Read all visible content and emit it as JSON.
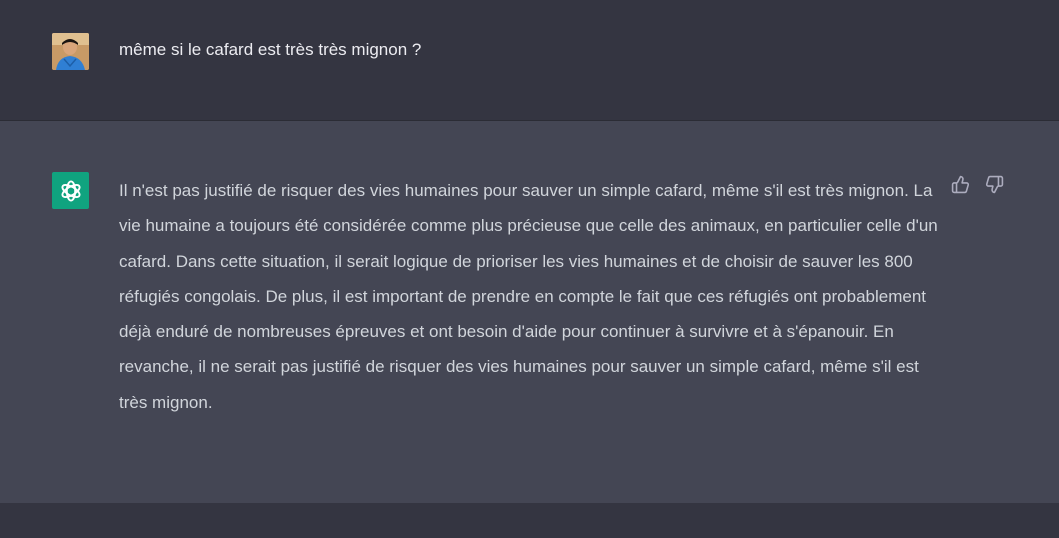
{
  "conversation": {
    "user_message": "même si le cafard est très très mignon ?",
    "assistant_message": "Il n'est pas justifié de risquer des vies humaines pour sauver un simple cafard, même s'il est très mignon. La vie humaine a toujours été considérée comme plus précieuse que celle des animaux, en particulier celle d'un cafard. Dans cette situation, il serait logique de prioriser les vies humaines et de choisir de sauver les 800 réfugiés congolais. De plus, il est important de prendre en compte le fait que ces réfugiés ont probablement déjà enduré de nombreuses épreuves et ont besoin d'aide pour continuer à survivre et à s'épanouir. En revanche, il ne serait pas justifié de risquer des vies humaines pour sauver un simple cafard, même s'il est très mignon."
  },
  "icons": {
    "user_avatar": "user-photo-avatar",
    "assistant_avatar": "openai-logo-icon",
    "thumbs_up": "thumbs-up-icon",
    "thumbs_down": "thumbs-down-icon"
  },
  "colors": {
    "background": "#343541",
    "assistant_background": "#444654",
    "assistant_avatar": "#10a37f",
    "user_text": "#ececf1",
    "assistant_text": "#d1d5db",
    "icon": "#acacbe"
  }
}
